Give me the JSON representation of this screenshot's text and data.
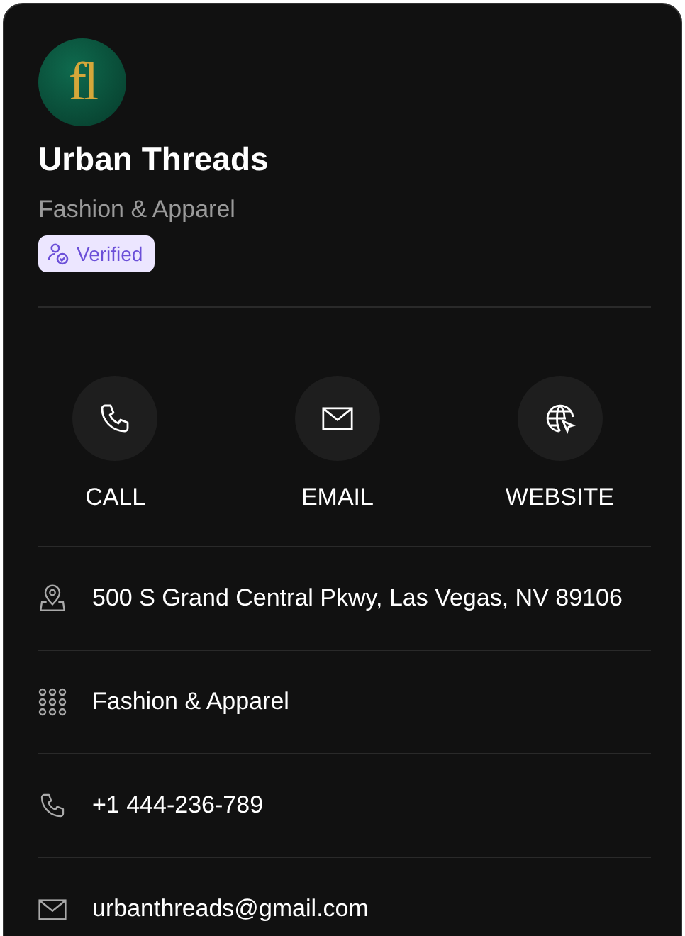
{
  "profile": {
    "logo": "fl",
    "name": "Urban Threads",
    "category": "Fashion & Apparel",
    "badge": "Verified"
  },
  "actions": [
    {
      "kind": "call",
      "label": "CALL"
    },
    {
      "kind": "email",
      "label": "EMAIL"
    },
    {
      "kind": "website",
      "label": "WEBSITE"
    }
  ],
  "details": [
    {
      "kind": "address",
      "text": "500 S Grand Central Pkwy, Las Vegas, NV 89106"
    },
    {
      "kind": "category",
      "text": "Fashion & Apparel"
    },
    {
      "kind": "phone",
      "text": "+1 444-236-789"
    },
    {
      "kind": "email",
      "text": "urbanthreads@gmail.com"
    }
  ]
}
